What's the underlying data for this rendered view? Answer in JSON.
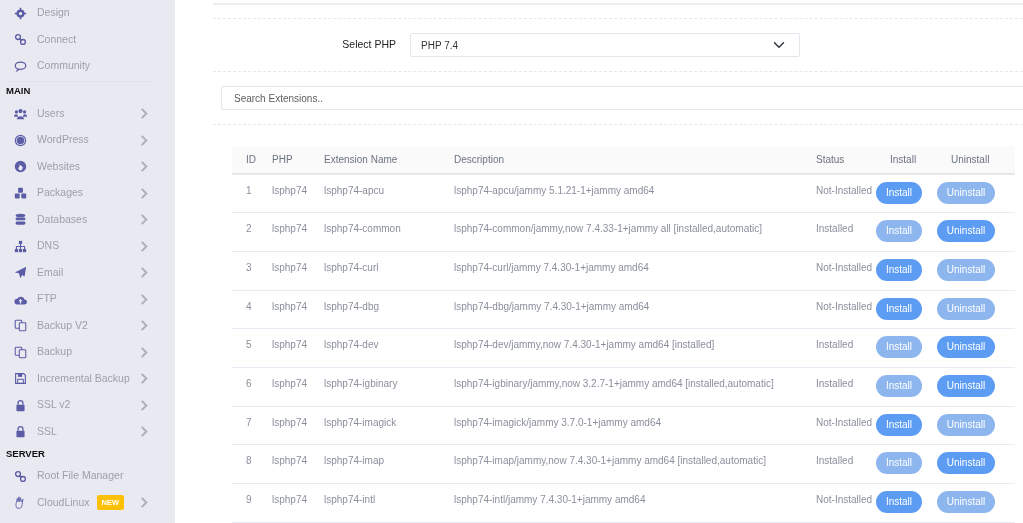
{
  "sidebar": {
    "items": [
      {
        "kind": "item",
        "label": "Design",
        "expandable": false
      },
      {
        "kind": "item",
        "label": "Connect",
        "expandable": false
      },
      {
        "kind": "item",
        "label": "Community",
        "expandable": false
      },
      {
        "kind": "heading",
        "label": "MAIN"
      },
      {
        "kind": "item",
        "label": "Users",
        "expandable": true
      },
      {
        "kind": "item",
        "label": "WordPress",
        "expandable": true
      },
      {
        "kind": "item",
        "label": "Websites",
        "expandable": true
      },
      {
        "kind": "item",
        "label": "Packages",
        "expandable": true
      },
      {
        "kind": "item",
        "label": "Databases",
        "expandable": true
      },
      {
        "kind": "item",
        "label": "DNS",
        "expandable": true
      },
      {
        "kind": "item",
        "label": "Email",
        "expandable": true
      },
      {
        "kind": "item",
        "label": "FTP",
        "expandable": true
      },
      {
        "kind": "item",
        "label": "Backup V2",
        "expandable": true
      },
      {
        "kind": "item",
        "label": "Backup",
        "expandable": true
      },
      {
        "kind": "item",
        "label": "Incremental Backup",
        "expandable": true
      },
      {
        "kind": "item",
        "label": "SSL v2",
        "expandable": true
      },
      {
        "kind": "item",
        "label": "SSL",
        "expandable": true
      },
      {
        "kind": "heading",
        "label": "SERVER"
      },
      {
        "kind": "item",
        "label": "Root File Manager",
        "expandable": false
      },
      {
        "kind": "item",
        "label": "CloudLinux",
        "badge": "NEW",
        "expandable": true
      }
    ]
  },
  "php_select": {
    "label": "Select PHP",
    "value": "PHP 7.4"
  },
  "search": {
    "placeholder": "Search Extensions.."
  },
  "table": {
    "columns": [
      "ID",
      "PHP",
      "Extension Name",
      "Description",
      "Status",
      "Install",
      "Uninstall"
    ],
    "rows": [
      {
        "id": "1",
        "php": "lsphp74",
        "name": "lsphp74-apcu",
        "description": "lsphp74-apcu/jammy 5.1.21-1+jammy amd64",
        "status": "Not-Installed",
        "install": {
          "label": "Install",
          "disabled": false
        },
        "uninstall": {
          "label": "Uninstall",
          "disabled": true
        }
      },
      {
        "id": "2",
        "php": "lsphp74",
        "name": "lsphp74-common",
        "description": "lsphp74-common/jammy,now 7.4.33-1+jammy all [installed,automatic]",
        "status": "Installed",
        "install": {
          "label": "Install",
          "disabled": true
        },
        "uninstall": {
          "label": "Uninstall",
          "disabled": false
        }
      },
      {
        "id": "3",
        "php": "lsphp74",
        "name": "lsphp74-curl",
        "description": "lsphp74-curl/jammy 7.4.30-1+jammy amd64",
        "status": "Not-Installed",
        "install": {
          "label": "Install",
          "disabled": false
        },
        "uninstall": {
          "label": "Uninstall",
          "disabled": true
        }
      },
      {
        "id": "4",
        "php": "lsphp74",
        "name": "lsphp74-dbg",
        "description": "lsphp74-dbg/jammy 7.4.30-1+jammy amd64",
        "status": "Not-Installed",
        "install": {
          "label": "Install",
          "disabled": false
        },
        "uninstall": {
          "label": "Uninstall",
          "disabled": true
        }
      },
      {
        "id": "5",
        "php": "lsphp74",
        "name": "lsphp74-dev",
        "description": "lsphp74-dev/jammy,now 7.4.30-1+jammy amd64 [installed]",
        "status": "Installed",
        "install": {
          "label": "Install",
          "disabled": true
        },
        "uninstall": {
          "label": "Uninstall",
          "disabled": false
        }
      },
      {
        "id": "6",
        "php": "lsphp74",
        "name": "lsphp74-igbinary",
        "description": "lsphp74-igbinary/jammy,now 3.2.7-1+jammy amd64 [installed,automatic]",
        "status": "Installed",
        "install": {
          "label": "Install",
          "disabled": true
        },
        "uninstall": {
          "label": "Uninstall",
          "disabled": false
        }
      },
      {
        "id": "7",
        "php": "lsphp74",
        "name": "lsphp74-imagick",
        "description": "lsphp74-imagick/jammy 3.7.0-1+jammy amd64",
        "status": "Not-Installed",
        "install": {
          "label": "Install",
          "disabled": false
        },
        "uninstall": {
          "label": "Uninstall",
          "disabled": true
        }
      },
      {
        "id": "8",
        "php": "lsphp74",
        "name": "lsphp74-imap",
        "description": "lsphp74-imap/jammy,now 7.4.30-1+jammy amd64 [installed,automatic]",
        "status": "Installed",
        "install": {
          "label": "Install",
          "disabled": true
        },
        "uninstall": {
          "label": "Uninstall",
          "disabled": false
        }
      },
      {
        "id": "9",
        "php": "lsphp74",
        "name": "lsphp74-intl",
        "description": "lsphp74-intl/jammy 7.4.30-1+jammy amd64",
        "status": "Not-Installed",
        "install": {
          "label": "Install",
          "disabled": false
        },
        "uninstall": {
          "label": "Uninstall",
          "disabled": true
        }
      }
    ]
  }
}
